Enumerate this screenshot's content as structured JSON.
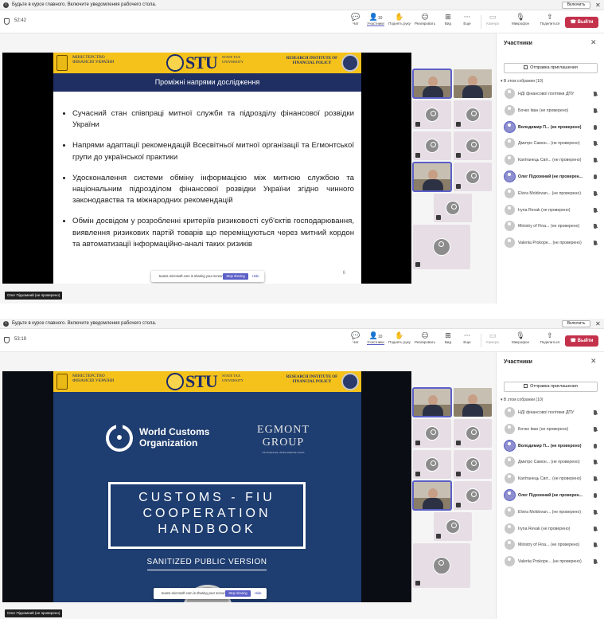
{
  "top_shot": {
    "notification": {
      "info_icon": "i",
      "message": "Будьте в курсе главного. Включите уведомления рабочего стола.",
      "enable_button": "Включить",
      "close_icon": "✕"
    },
    "toolbar": {
      "timer": "52:42",
      "chat": "Чат",
      "participants": "Участники",
      "participants_count": "10",
      "raise_hand": "Поднять руку",
      "react": "Реагировать",
      "view": "Вид",
      "more": "Еще",
      "camera": "Камера",
      "mic": "Микрофон",
      "share": "Поделиться",
      "leave": "Выйти"
    },
    "slide": {
      "ministry": "МІНІСТЕРСТВО ФІНАНСІВ УКРАЇНИ",
      "stu": "STU",
      "stu_words": "STATE TAX UNIVERSITY",
      "research": "RESEARCH INSTITUTE OF FINANCIAL POLICY",
      "title": "Проміжні напрями дослідження",
      "bullets": [
        "Сучасний стан співпраці митної служби та підрозділу фінансової розвідки України",
        "Напрями адаптації рекомендацій Всесвітньої митної організації та Егмонтської групи до української практики",
        "Удосконалення системи обміну інформацією між митною службою та національним підрозділом фінансової розвідки України згідно чинного законодавства та міжнародних рекомендацій",
        "Обмін досвідом у розробленні критеріїв ризиковості суб'єктів господарювання, виявлення ризикових партій товарів що переміщуються через митний кордон та автоматизації інформаційно-аналі таких ризиків"
      ],
      "page_number": "6"
    },
    "share_toast": {
      "message": "teams.microsoft.com is sharing your screen.",
      "stop": "Stop sharing",
      "hide": "Hide"
    },
    "presenter_label": "Олег Підхомний (не проверено)"
  },
  "bottom_shot": {
    "notification": {
      "info_icon": "i",
      "message": "Будьте в курсе главного. Включите уведомления рабочего стола.",
      "enable_button": "Включить",
      "close_icon": "✕"
    },
    "toolbar": {
      "timer": "53:19",
      "chat": "Чат",
      "participants": "Участники",
      "participants_count": "10",
      "raise_hand": "Поднять руку",
      "react": "Реагировать",
      "view": "Вид",
      "more": "Еще",
      "camera": "Камера",
      "mic": "Микрофон",
      "share": "Поделиться",
      "leave": "Выйти"
    },
    "slide": {
      "ministry": "МІНІСТЕРСТВО ФІНАНСІВ УКРАЇНИ",
      "stu": "STU",
      "stu_words": "STATE TAX UNIVERSITY",
      "research": "RESEARCH INSTITUTE OF FINANCIAL POLICY",
      "wco": "World Customs Organization",
      "egmont": "EGMONT GROUP",
      "egmont_sub": "OF FINANCIAL INTELLIGENCE UNITS",
      "handbook_line1": "CUSTOMS - FIU",
      "handbook_line2": "COOPERATION",
      "handbook_line3": "HANDBOOK",
      "sanitized": "SANITIZED PUBLIC VERSION"
    },
    "share_toast": {
      "message": "teams.microsoft.com is sharing your screen.",
      "stop": "Stop sharing",
      "hide": "Hide"
    },
    "presenter_label": "Олег Підхомний (не проверено)"
  },
  "panel": {
    "title": "Участники",
    "close_icon": "✕",
    "invite": "Отправка приглашения",
    "section": "▾ В этом собрании (10)",
    "participants": [
      {
        "name": "НДІ фінансової політики ДПУ",
        "bold": false,
        "speaking": false,
        "muted": true
      },
      {
        "name": "Бочко Іван (не проверено)",
        "bold": false,
        "speaking": false,
        "muted": true
      },
      {
        "name": "Володимир П... (не проверено)",
        "bold": true,
        "speaking": true,
        "muted": false
      },
      {
        "name": "Дмитро Самон... (не проверено)",
        "bold": false,
        "speaking": false,
        "muted": true
      },
      {
        "name": "Капітанець Світ... (не проверено)",
        "bold": false,
        "speaking": false,
        "muted": true
      },
      {
        "name": "Олег Підхомний (не проверен...",
        "bold": true,
        "speaking": true,
        "muted": false
      },
      {
        "name": "Elvira Moldovan... (не проверено)",
        "bold": false,
        "speaking": false,
        "muted": true
      },
      {
        "name": "Iryna Revak (не проверено)",
        "bold": false,
        "speaking": false,
        "muted": true
      },
      {
        "name": "Ministry of Fina... (не проверено)",
        "bold": false,
        "speaking": false,
        "muted": true
      },
      {
        "name": "Valeriia Prokope... (не проверено)",
        "bold": false,
        "speaking": false,
        "muted": true
      }
    ]
  },
  "colors": {
    "accent": "#5b5fc7",
    "leave": "#c4314b",
    "slide_header": "#f4c21a",
    "slide_titlebar": "#1f2f63",
    "handbook_bg": "#1e3d70"
  },
  "icons": [
    "info-icon",
    "shield-icon",
    "chat-icon",
    "people-icon",
    "hand-icon",
    "emoji-icon",
    "grid-icon",
    "more-icon",
    "camera-icon",
    "mic-icon",
    "share-icon",
    "phone-icon",
    "close-icon",
    "invite-icon",
    "avatar-icon",
    "mic-muted-icon"
  ]
}
